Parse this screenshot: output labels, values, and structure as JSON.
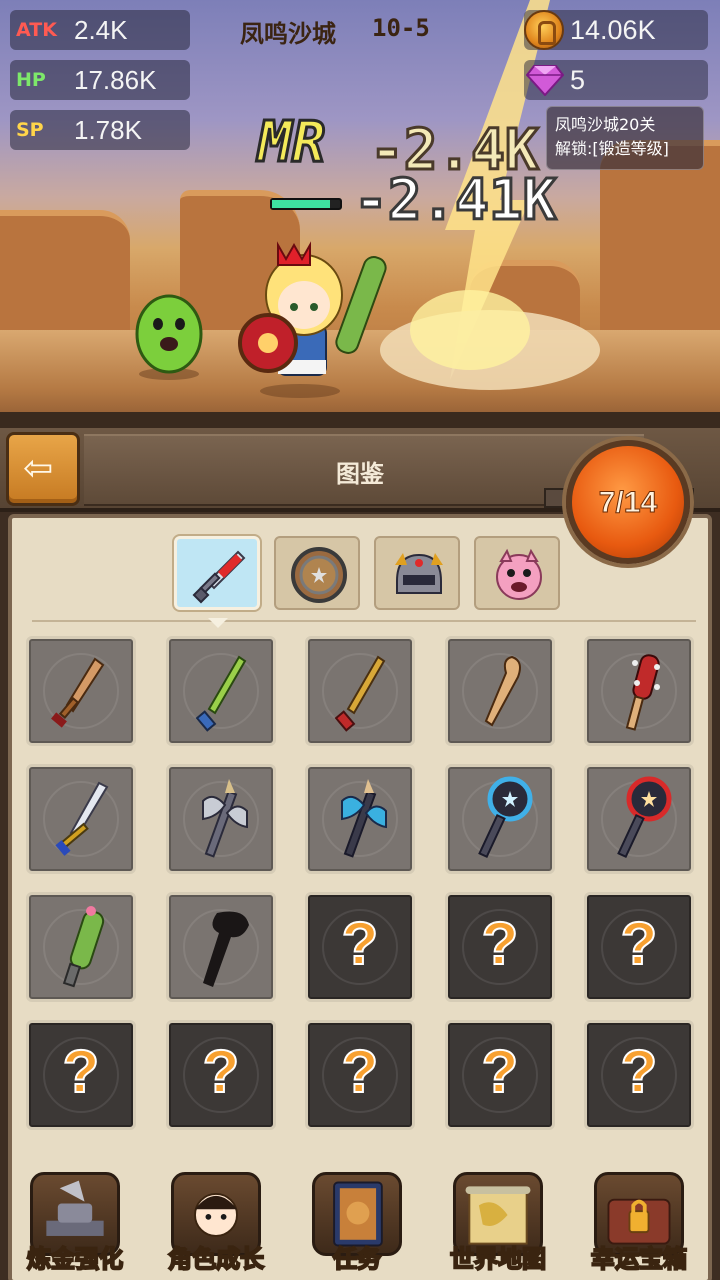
{
  "stats": {
    "atk": {
      "label": "ATK",
      "value": "2.4K"
    },
    "hp": {
      "label": "HP",
      "value": "17.86K"
    },
    "sp": {
      "label": "SP",
      "value": "1.78K"
    }
  },
  "stage": {
    "name": "凤鸣沙城",
    "number": "10-5"
  },
  "resources": {
    "gold": "14.06K",
    "gems": "5"
  },
  "unlock_info": {
    "line1": "凤鸣沙城20关",
    "line2": "解锁:[锻造等级]"
  },
  "battle": {
    "float_mr": "MR",
    "damage_1": "-2.4K",
    "damage_2": "-2.41K",
    "enemy_hp_fraction": 0.85
  },
  "codex": {
    "title": "图鉴",
    "progress": "7/14",
    "tabs": [
      {
        "icon": "sword-icon",
        "active": true
      },
      {
        "icon": "shield-icon",
        "active": false
      },
      {
        "icon": "helmet-icon",
        "active": false
      },
      {
        "icon": "pet-icon",
        "active": false
      }
    ],
    "items": [
      {
        "icon": "wooden-sword-icon",
        "locked": false
      },
      {
        "icon": "green-blade-icon",
        "locked": false
      },
      {
        "icon": "golden-blade-icon",
        "locked": false
      },
      {
        "icon": "wooden-club-icon",
        "locked": false
      },
      {
        "icon": "spiked-club-icon",
        "locked": false
      },
      {
        "icon": "steel-sword-icon",
        "locked": false
      },
      {
        "icon": "battle-axe-icon",
        "locked": false
      },
      {
        "icon": "blue-axe-icon",
        "locked": false
      },
      {
        "icon": "blue-star-mace-icon",
        "locked": false
      },
      {
        "icon": "red-star-mace-icon",
        "locked": false
      },
      {
        "icon": "cactus-club-icon",
        "locked": false
      },
      {
        "icon": "silhouette-weapon-icon",
        "locked": false
      },
      {
        "icon": "question-mark-icon",
        "locked": true,
        "text": "?"
      },
      {
        "icon": "question-mark-icon",
        "locked": true,
        "text": "?"
      },
      {
        "icon": "question-mark-icon",
        "locked": true,
        "text": "?"
      },
      {
        "icon": "question-mark-icon",
        "locked": true,
        "text": "?"
      },
      {
        "icon": "question-mark-icon",
        "locked": true,
        "text": "?"
      },
      {
        "icon": "question-mark-icon",
        "locked": true,
        "text": "?"
      },
      {
        "icon": "question-mark-icon",
        "locked": true,
        "text": "?"
      },
      {
        "icon": "question-mark-icon",
        "locked": true,
        "text": "?"
      }
    ]
  },
  "nav": [
    {
      "label": "炼金强化",
      "icon": "anvil-icon"
    },
    {
      "label": "角色成长",
      "icon": "hero-icon"
    },
    {
      "label": "任务",
      "icon": "quest-book-icon"
    },
    {
      "label": "世界地图",
      "icon": "map-scroll-icon"
    },
    {
      "label": "幸运宝箱",
      "icon": "locked-chest-icon"
    }
  ],
  "colors": {
    "accent": "#e85a10",
    "gold": "#e0851c",
    "gem": "#d25ad8",
    "question": "#f7a030"
  }
}
